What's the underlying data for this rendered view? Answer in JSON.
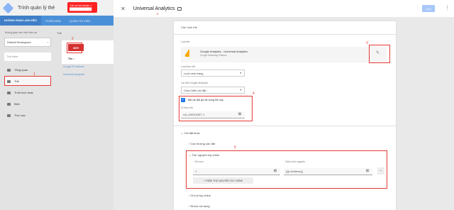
{
  "app": {
    "title": "Trình quản lý thẻ",
    "account_line1": "Tất cả tài khoản > ",
    "account_line2": "███████████"
  },
  "tabs": [
    "KHÔNG GIAN LÀM VIỆC",
    "PHIÊN BẢN",
    "QUẢN TRỊ VIÊN"
  ],
  "sidebar": {
    "workspace_label": "Không gian làm việc hiện tại",
    "workspace_value": "Default Workspace",
    "search_placeholder": "Tìm kiếm",
    "items": [
      "Tổng quan",
      "Thẻ",
      "Trình kích hoạt",
      "Biến",
      "Thư mục"
    ]
  },
  "middle": {
    "header": "Thẻ",
    "new_button": "MỚI",
    "name_col": "Tên ↑",
    "rows": [
      "Google IP address",
      "Universal Analytics"
    ]
  },
  "annotations": {
    "a1": "1",
    "a2": "2",
    "a3": "3",
    "a4": "4",
    "a5": "5",
    "c": "c"
  },
  "panel": {
    "title": "Universal Analytics",
    "save": "LƯU",
    "config_header": "Cấu hình thẻ",
    "tag_type_label": "Loại thẻ",
    "tag_type_name": "Google Analytics - Universal Analytics",
    "tag_type_sub": "Google Marketing Platform",
    "track_type_label": "Loại theo dõi",
    "track_type_value": "Lượt xem trang",
    "ga_settings_label": "Cài đặt Google Analytics",
    "ga_settings_value": "Chọn biến cài đặt...",
    "override_text": "Bật cài đặt ghi đè trong thẻ này",
    "tracking_id_label": "ID theo dõi",
    "tracking_id_value": "UA-119010257-1",
    "advanced": "Cài đặt khác",
    "fields_to_set": "Các trường cần đặt",
    "custom_dims": "Thứ nguyên tùy chỉnh",
    "index_label": "Chỉ mục",
    "index_value": "1",
    "dim_value_label": "Giá trị thứ nguyên",
    "dim_value": "{{ip Address}}",
    "add_dim_button": "+ THÊM THỨ NGUYÊN TÙY CHỈNH",
    "custom_metrics": "Chỉ số tùy chỉnh",
    "content_groups": "Nhóm nội dung"
  },
  "colors": {
    "accent": "#4a90d9",
    "annotation": "#e53935",
    "new_button": "#d32f2f",
    "ga": "#f9ab00"
  }
}
